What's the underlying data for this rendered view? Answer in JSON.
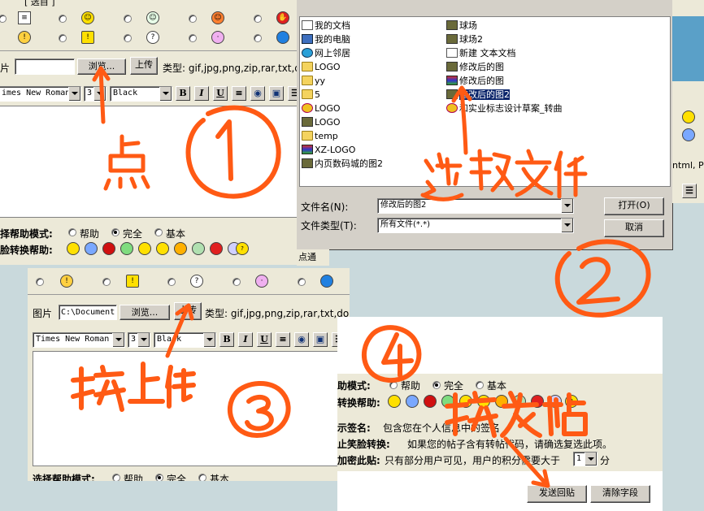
{
  "panel1": {
    "title_fragment": "[ 选自 ]",
    "file_label_fragment": "片",
    "browse_label": "浏览...",
    "upload_label": "上传",
    "types_label": "类型: gif,jpg,png,zip,rar,txt,doc",
    "font_select": "imes New Roman",
    "size_select": "3",
    "color_select": "Black",
    "mode_label": "择帮助模式:",
    "mode_options": [
      "帮助",
      "完全",
      "基本"
    ],
    "smiley_label": "脸转换帮助:"
  },
  "panel2": {
    "files_left": [
      "我的文档",
      "我的电脑",
      "网上邻居",
      "LOGO",
      "yy",
      "5",
      "LOGO",
      "LOGO",
      "temp",
      "XZ-LOGO",
      "内页数码城的图2"
    ],
    "files_right": [
      "球场",
      "球场2",
      "新建 文本文档",
      "修改后的图",
      "修改后的图",
      "修改后的图2",
      "和实业标志设计草案_转曲"
    ],
    "filename_label": "文件名(N):",
    "filename_value": "修改后的图2",
    "filetype_label": "文件类型(T):",
    "filetype_value": "所有文件(*.*)",
    "open_label": "打开(O)",
    "cancel_label": "取消",
    "right_text": "ntml, P",
    "bottom_fragment": "点通"
  },
  "panel3": {
    "file_label": "图片",
    "file_value": "C:\\Document",
    "browse_label": "浏览...",
    "upload_label": "上传",
    "types_label": "类型: gif,jpg,png,zip,rar,txt,doc",
    "font_select": "Times New Roman",
    "size_select": "3",
    "color_select": "Black",
    "mode_label": "选择帮助模式:",
    "mode_options": [
      "帮助",
      "完全",
      "基本"
    ]
  },
  "panel4": {
    "mode_label": "助模式:",
    "mode_options": [
      "帮助",
      "完全",
      "基本"
    ],
    "smiley_label": "转换帮助:",
    "sig_label": "示签名:",
    "sig_text": "包含您在个人信息中的签名",
    "disable_label": "止笑脸转换:",
    "disable_text": "如果您的帖子含有转帖代码，请确选复选此项。",
    "encrypt_label": "加密此贴:",
    "encrypt_text": "只有部分用户可见，用户的积分需要大于",
    "encrypt_value": "1",
    "encrypt_unit": "分",
    "submit_label": "发送回贴",
    "clear_label": "清除字段"
  },
  "colors": {
    "annotation": "#ff5a14",
    "selection": "#0a246a",
    "button_face": "#d4d0c8"
  }
}
